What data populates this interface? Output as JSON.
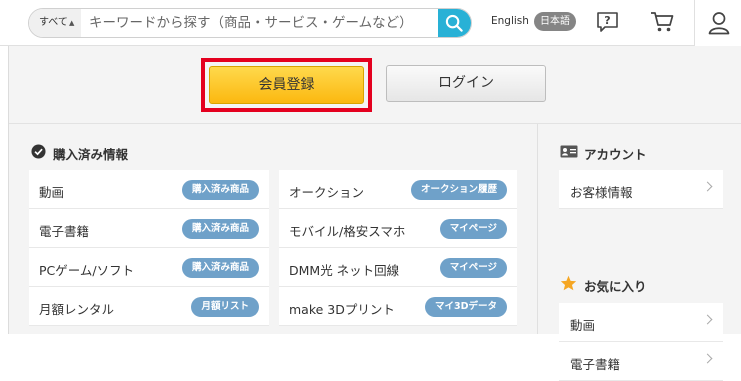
{
  "search": {
    "scope": "すべて",
    "scope_arrow": "▲▼",
    "placeholder": "キーワードから探す（商品・サービス・ゲームなど）"
  },
  "header": {
    "lang_english": "English",
    "lang_japanese": "日本語"
  },
  "cta": {
    "register_label": "会員登録",
    "login_label": "ログイン"
  },
  "purchased": {
    "heading": "購入済み情報",
    "left_items": [
      {
        "label": "動画",
        "badge": "購入済み商品"
      },
      {
        "label": "電子書籍",
        "badge": "購入済み商品"
      },
      {
        "label": "PCゲーム/ソフト",
        "badge": "購入済み商品"
      },
      {
        "label": "月額レンタル",
        "badge": "月額リスト"
      }
    ],
    "right_items": [
      {
        "label": "オークション",
        "badge": "オークション履歴"
      },
      {
        "label": "モバイル/格安スマホ",
        "badge": "マイページ"
      },
      {
        "label": "DMM光 ネット回線",
        "badge": "マイページ"
      },
      {
        "label": "make 3Dプリント",
        "badge": "マイ3Dデータ"
      }
    ]
  },
  "account": {
    "heading": "アカウント",
    "items": [
      {
        "label": "お客様情報"
      }
    ]
  },
  "favorites": {
    "heading": "お気に入り",
    "items": [
      {
        "label": "動画"
      },
      {
        "label": "電子書籍"
      }
    ]
  },
  "colors": {
    "accent": "#28b1d6",
    "highlight_frame": "#e4001f",
    "register_button": "#fbb810",
    "badge": "#6fa1c9",
    "star": "#f5a623"
  },
  "icons": [
    "search-icon",
    "help-icon",
    "cart-icon",
    "user-icon",
    "check-circle-icon",
    "id-card-icon",
    "star-icon",
    "chevron-right-icon"
  ]
}
